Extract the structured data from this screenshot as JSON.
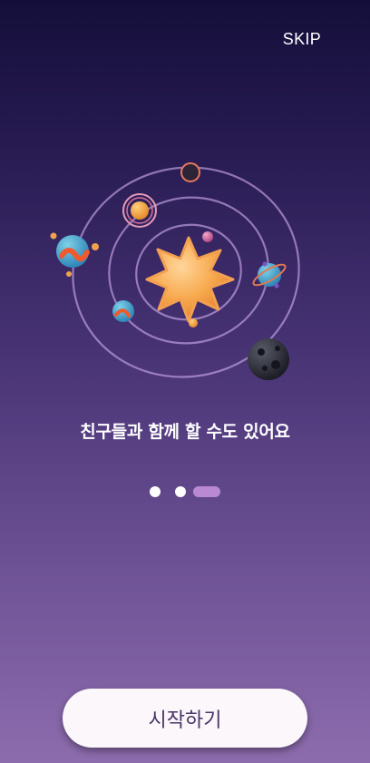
{
  "header": {
    "skip_label": "SKIP"
  },
  "onboarding": {
    "headline": "친구들과 함께 할 수도 있어요",
    "page_total": 3,
    "page_current": 3
  },
  "footer": {
    "start_label": "시작하기"
  },
  "colors": {
    "background_top": "#140f3a",
    "background_bottom": "#8d6cad",
    "indicator_active": "#b98ad3",
    "indicator_inactive": "#ffffff",
    "button_bg": "#fbf7fb",
    "button_text": "#4a3565"
  }
}
